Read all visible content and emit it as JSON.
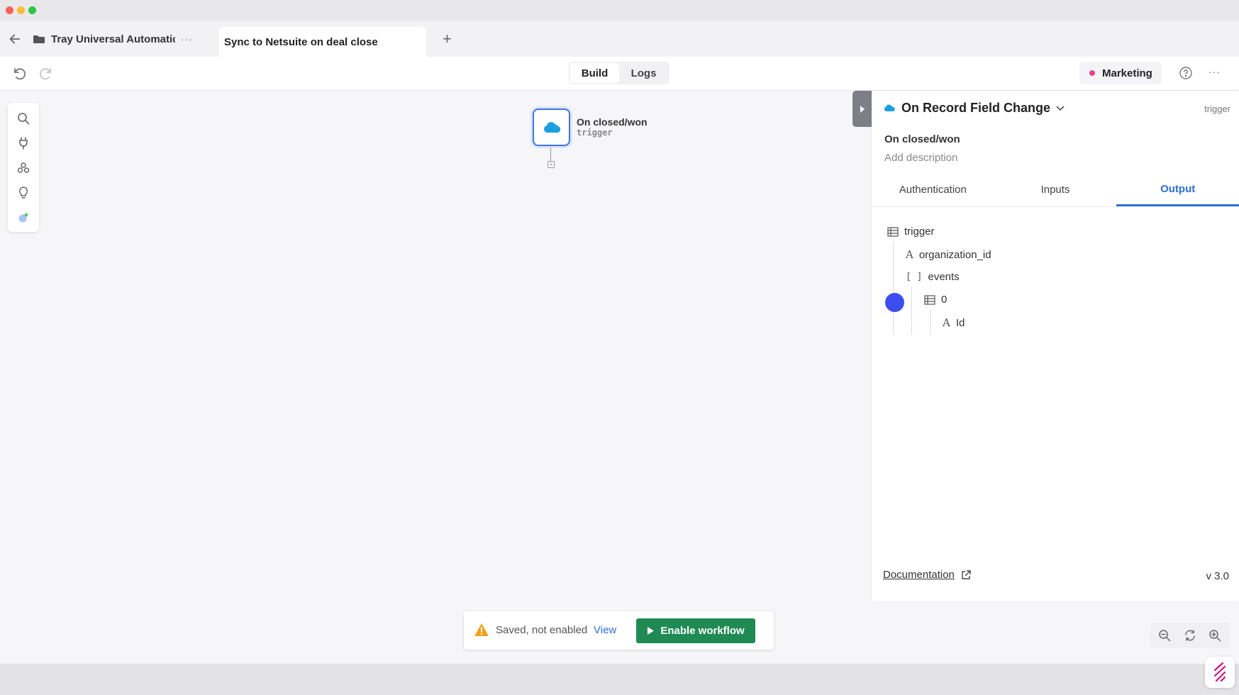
{
  "tabs": {
    "project_label": "Tray Universal Automatic",
    "project_more": "···",
    "workflow_label": "Sync to Netsuite on deal close",
    "add_tab": "+"
  },
  "toolbar": {
    "modes": [
      "Build",
      "Logs"
    ],
    "active_mode": "Build",
    "environment": "Marketing",
    "menu": "···"
  },
  "node": {
    "title": "On closed/won",
    "subtitle": "trigger",
    "icon": "salesforce-cloud-icon"
  },
  "panel": {
    "operation": "On Record Field Change",
    "type": "trigger",
    "step_name": "On closed/won",
    "add_description": "Add description",
    "tabs": [
      "Authentication",
      "Inputs",
      "Output"
    ],
    "active_tab": "Output",
    "tree": {
      "root": "trigger",
      "field1": "organization_id",
      "field2": "events",
      "index0": "0",
      "id": "Id"
    },
    "documentation": "Documentation",
    "version": "v 3.0"
  },
  "status": {
    "text": "Saved, not enabled",
    "view": "View",
    "enable": "Enable workflow"
  },
  "colors": {
    "accent": "#2c6fd6",
    "enable_green": "#208a55",
    "env_pink": "#e8418b",
    "cursor_blue": "#3d4ef0"
  }
}
